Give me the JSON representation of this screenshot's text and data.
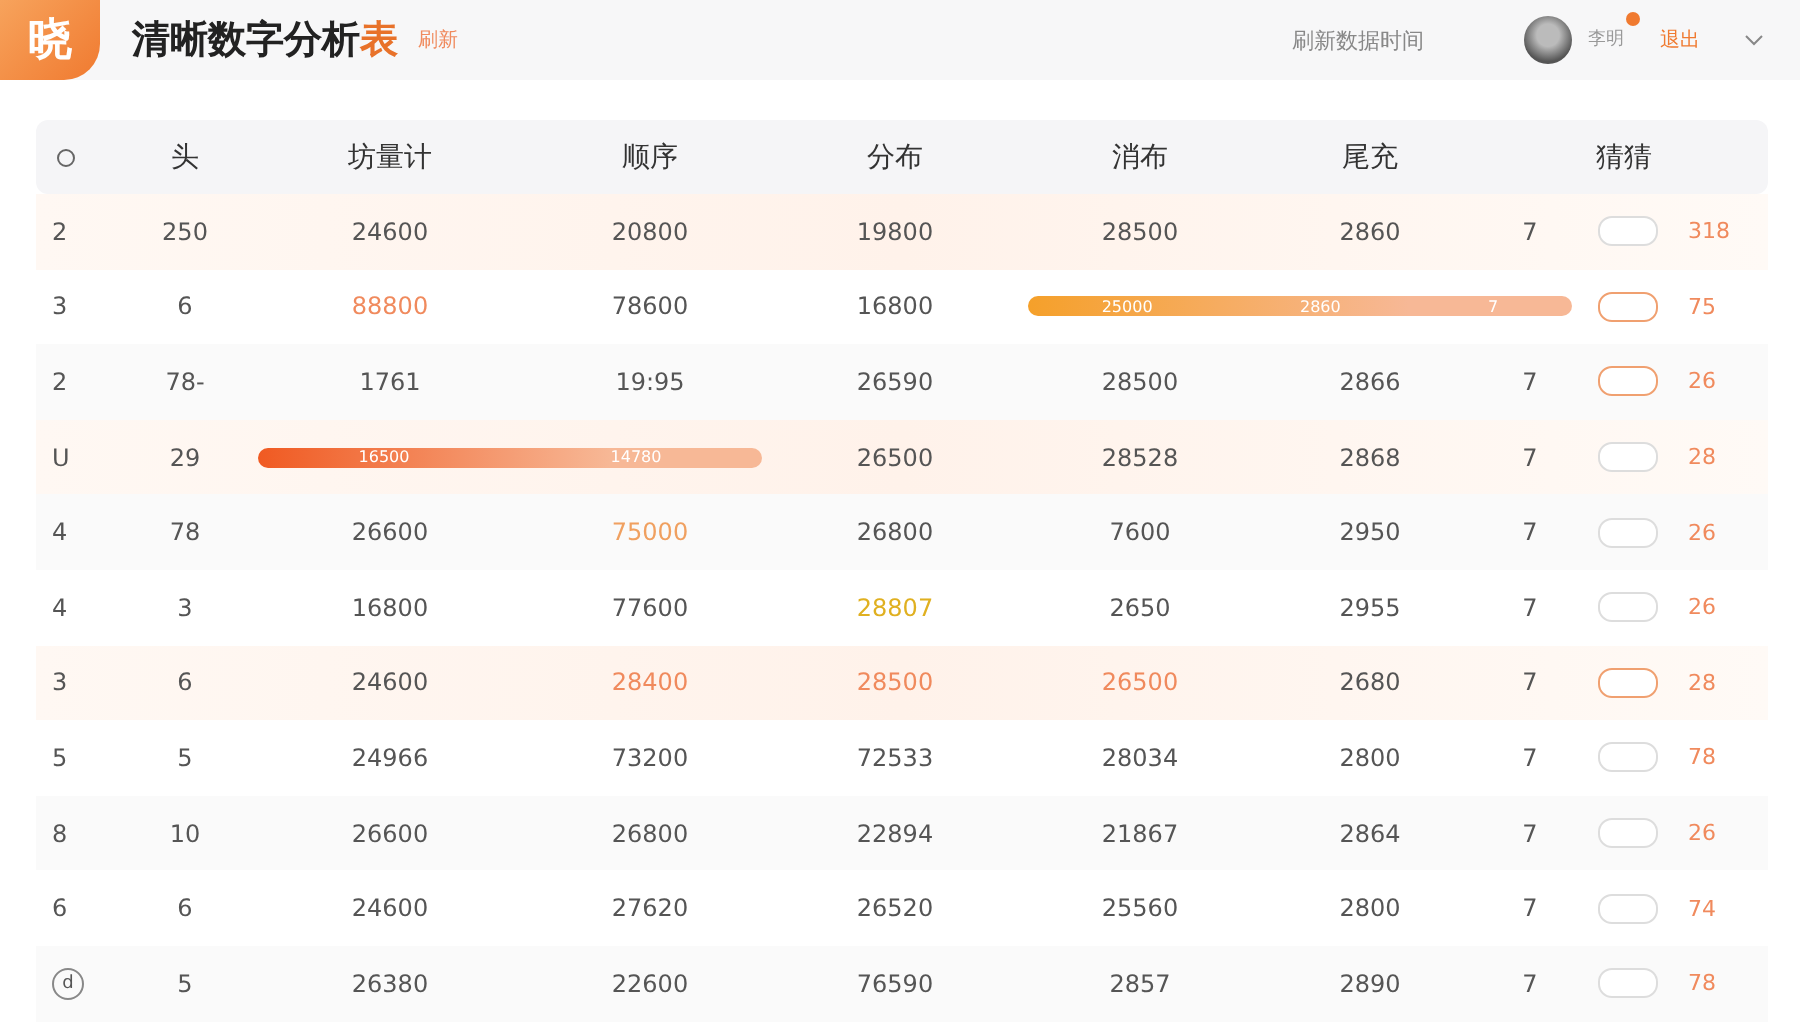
{
  "header": {
    "logo": "晓",
    "title": "清晰数字分析",
    "title_accent": "表",
    "tag": "刷新",
    "update_text": "刷新数据时间",
    "user": {
      "name": "李明",
      "has_badge": true
    },
    "logout": "退出"
  },
  "table": {
    "columns": [
      "头",
      "坊量计",
      "顺序",
      "分布",
      "消布",
      "尾充",
      "猜猜"
    ],
    "rows": [
      {
        "highlighted": true,
        "index": "2",
        "circled": false,
        "cells": [
          {
            "kind": "text",
            "text": "250"
          },
          {
            "kind": "text",
            "text": "24600"
          },
          {
            "kind": "text",
            "text": "20800"
          },
          {
            "kind": "text",
            "text": "19800"
          },
          {
            "kind": "text",
            "text": "28500"
          },
          {
            "kind": "text",
            "text": "2860"
          },
          {
            "kind": "text",
            "text": "7"
          }
        ],
        "toggle_on": false,
        "score": "318"
      },
      {
        "highlighted": false,
        "index": "3",
        "circled": false,
        "cells": [
          {
            "kind": "text",
            "text": "6"
          },
          {
            "kind": "text",
            "text": "88800",
            "color": "#f08a5d"
          },
          {
            "kind": "text",
            "text": "78600"
          },
          {
            "kind": "text",
            "text": "16800"
          },
          {
            "kind": "bar",
            "text": "25000",
            "color": "#f5a02a"
          },
          {
            "kind": "bar",
            "text": "2860"
          },
          {
            "kind": "bar",
            "text": "7"
          }
        ],
        "toggle_on": true,
        "score": "75"
      },
      {
        "highlighted": false,
        "index": "2",
        "circled": false,
        "cells": [
          {
            "kind": "text",
            "text": "78-"
          },
          {
            "kind": "text",
            "text": "1761"
          },
          {
            "kind": "text",
            "text": "19:95"
          },
          {
            "kind": "text",
            "text": "26590"
          },
          {
            "kind": "text",
            "text": "28500"
          },
          {
            "kind": "text",
            "text": "2866"
          },
          {
            "kind": "text",
            "text": "7"
          }
        ],
        "toggle_on": true,
        "score": "26"
      },
      {
        "highlighted": true,
        "index": "U",
        "circled": false,
        "cells": [
          {
            "kind": "text",
            "text": "29"
          },
          {
            "kind": "bar",
            "text": "16500",
            "color": "#f05a22"
          },
          {
            "kind": "bar",
            "text": "14780"
          },
          {
            "kind": "text",
            "text": "26500"
          },
          {
            "kind": "text",
            "text": "28528"
          },
          {
            "kind": "text",
            "text": "2868"
          },
          {
            "kind": "text",
            "text": "7"
          }
        ],
        "toggle_on": false,
        "score": "28"
      },
      {
        "highlighted": false,
        "index": "4",
        "circled": false,
        "cells": [
          {
            "kind": "text",
            "text": "78"
          },
          {
            "kind": "text",
            "text": "26600"
          },
          {
            "kind": "text",
            "text": "75000",
            "color": "#f0a060"
          },
          {
            "kind": "text",
            "text": "26800"
          },
          {
            "kind": "text",
            "text": "7600"
          },
          {
            "kind": "text",
            "text": "2950"
          },
          {
            "kind": "text",
            "text": "7"
          }
        ],
        "toggle_on": false,
        "score": "26"
      },
      {
        "highlighted": false,
        "index": "4",
        "circled": false,
        "cells": [
          {
            "kind": "text",
            "text": "3"
          },
          {
            "kind": "text",
            "text": "16800"
          },
          {
            "kind": "text",
            "text": "77600"
          },
          {
            "kind": "text",
            "text": "28807",
            "color": "#e0b020"
          },
          {
            "kind": "text",
            "text": "2650"
          },
          {
            "kind": "text",
            "text": "2955"
          },
          {
            "kind": "text",
            "text": "7"
          }
        ],
        "toggle_on": false,
        "score": "26"
      },
      {
        "highlighted": true,
        "index": "3",
        "circled": false,
        "cells": [
          {
            "kind": "text",
            "text": "6"
          },
          {
            "kind": "text",
            "text": "24600"
          },
          {
            "kind": "text",
            "text": "28400",
            "color": "#f08a5d"
          },
          {
            "kind": "text",
            "text": "28500",
            "color": "#f08a5d"
          },
          {
            "kind": "text",
            "text": "26500",
            "color": "#f08a5d"
          },
          {
            "kind": "text",
            "text": "2680"
          },
          {
            "kind": "text",
            "text": "7"
          }
        ],
        "toggle_on": true,
        "score": "28"
      },
      {
        "highlighted": false,
        "index": "5",
        "circled": false,
        "cells": [
          {
            "kind": "text",
            "text": "5"
          },
          {
            "kind": "text",
            "text": "24966"
          },
          {
            "kind": "text",
            "text": "73200"
          },
          {
            "kind": "text",
            "text": "72533"
          },
          {
            "kind": "text",
            "text": "28034"
          },
          {
            "kind": "text",
            "text": "2800"
          },
          {
            "kind": "text",
            "text": "7"
          }
        ],
        "toggle_on": false,
        "score": "78"
      },
      {
        "highlighted": false,
        "index": "8",
        "circled": false,
        "cells": [
          {
            "kind": "text",
            "text": "10"
          },
          {
            "kind": "text",
            "text": "26600"
          },
          {
            "kind": "text",
            "text": "26800"
          },
          {
            "kind": "text",
            "text": "22894"
          },
          {
            "kind": "text",
            "text": "21867"
          },
          {
            "kind": "text",
            "text": "2864"
          },
          {
            "kind": "text",
            "text": "7"
          }
        ],
        "toggle_on": false,
        "score": "26"
      },
      {
        "highlighted": false,
        "index": "6",
        "circled": false,
        "cells": [
          {
            "kind": "text",
            "text": "6"
          },
          {
            "kind": "text",
            "text": "24600"
          },
          {
            "kind": "text",
            "text": "27620"
          },
          {
            "kind": "text",
            "text": "26520"
          },
          {
            "kind": "text",
            "text": "25560"
          },
          {
            "kind": "text",
            "text": "2800"
          },
          {
            "kind": "text",
            "text": "7"
          }
        ],
        "toggle_on": false,
        "score": "74"
      },
      {
        "highlighted": false,
        "index": "d",
        "circled": true,
        "cells": [
          {
            "kind": "text",
            "text": "5"
          },
          {
            "kind": "text",
            "text": "26380"
          },
          {
            "kind": "text",
            "text": "22600"
          },
          {
            "kind": "text",
            "text": "76590"
          },
          {
            "kind": "text",
            "text": "2857"
          },
          {
            "kind": "text",
            "text": "2890"
          },
          {
            "kind": "text",
            "text": "7"
          }
        ],
        "toggle_on": false,
        "score": "78"
      }
    ]
  }
}
